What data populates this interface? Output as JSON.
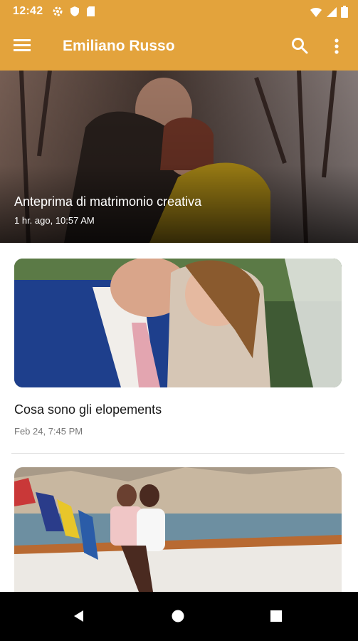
{
  "status_bar": {
    "time": "12:42",
    "left_icons": [
      "gear-icon",
      "shield-icon",
      "sd-card-icon"
    ],
    "right_icons": [
      "wifi-icon",
      "signal-icon",
      "battery-icon"
    ]
  },
  "app_bar": {
    "title": "Emiliano Russo",
    "background": "#e3a33c",
    "icons": [
      "menu-icon",
      "search-icon",
      "more-vert-icon"
    ]
  },
  "hero_post": {
    "title": "Anteprima di matrimonio creativa",
    "meta": "1 hr. ago, 10:57 AM"
  },
  "posts": [
    {
      "title": "Cosa sono gli elopements",
      "meta": "Feb 24, 7:45 PM"
    },
    {
      "title": "",
      "meta": ""
    }
  ],
  "nav_bar": {
    "buttons": [
      "back-icon",
      "home-icon",
      "recents-icon"
    ]
  }
}
